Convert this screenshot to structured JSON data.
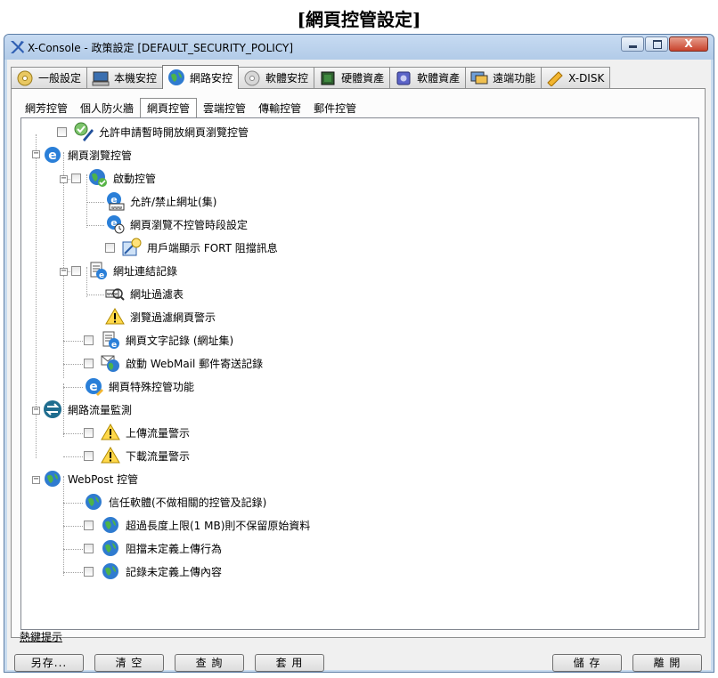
{
  "caption": "[網頁控管設定]",
  "window": {
    "title": "X-Console - 政策設定 [DEFAULT_SECURITY_POLICY]",
    "controls": {
      "minimize_icon": "minimize-icon",
      "maximize_icon": "maximize-icon",
      "close_label": "X"
    }
  },
  "main_tabs": [
    {
      "label": "一般設定",
      "icon": "cd-icon"
    },
    {
      "label": "本機安控",
      "icon": "computer-icon"
    },
    {
      "label": "網路安控",
      "icon": "globe-icon",
      "active": true
    },
    {
      "label": "軟體安控",
      "icon": "disc-icon"
    },
    {
      "label": "硬體資產",
      "icon": "chip-icon"
    },
    {
      "label": "軟體資產",
      "icon": "software-icon"
    },
    {
      "label": "遠端功能",
      "icon": "remote-desktop-icon"
    },
    {
      "label": "X-DISK",
      "icon": "disk-icon"
    }
  ],
  "sub_tabs": [
    {
      "label": "網芳控管"
    },
    {
      "label": "個人防火牆"
    },
    {
      "label": "網頁控管",
      "active": true
    },
    {
      "label": "雲端控管"
    },
    {
      "label": "傳輸控管"
    },
    {
      "label": "郵件控管"
    }
  ],
  "tree": {
    "allow_temp_open": "允許申請暫時開放網頁瀏覽控管",
    "web_browse": {
      "label": "網頁瀏覽控管",
      "enable_control": "啟動控管",
      "allow_block_urls": "允許/禁止網址(集)",
      "no_control_period": "網頁瀏覽不控管時段設定",
      "client_fort_block_msg": "用戶端顯示 FORT 阻擋訊息",
      "url_connection_log": "網址連結記錄",
      "url_filter_list": "網址過濾表",
      "filter_page_warning": "瀏覽過濾網頁警示",
      "page_text_log": "網頁文字記錄 (網址集)",
      "webmail_log": "啟動 WebMail 郵件寄送記錄",
      "special_control": "網頁特殊控管功能"
    },
    "traffic": {
      "label": "網路流量監測",
      "upload_warning": "上傳流量警示",
      "download_warning": "下載流量警示"
    },
    "webpost": {
      "label": "WebPost 控管",
      "trusted_software": "信任軟體(不做相關的控管及記錄)",
      "over_limit": "超過長度上限(1 MB)則不保留原始資料",
      "block_undefined": "阻擋未定義上傳行為",
      "log_undefined": "記錄未定義上傳內容"
    },
    "expander_glyph": "−"
  },
  "footer": {
    "hotkey_hint": "熱鍵提示",
    "save_as": "另存...",
    "clear": "清 空",
    "query": "查 詢",
    "apply": "套 用",
    "save": "儲 存",
    "leave": "離 開"
  },
  "colors": {
    "window_frame": "#c9dcef",
    "title_gradient_top": "#c7dbf2",
    "close_button": "#c8422c"
  }
}
